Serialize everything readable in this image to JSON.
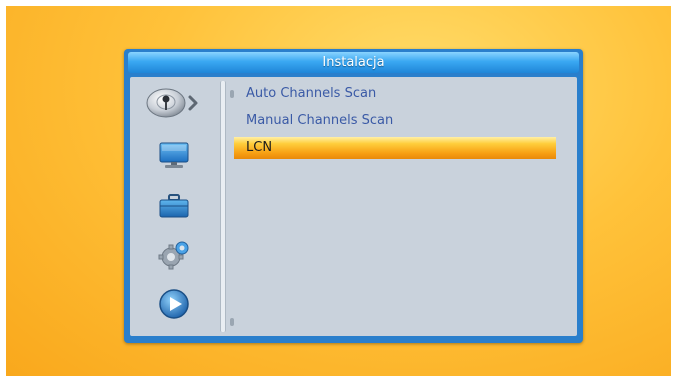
{
  "window": {
    "title": "Instalacja"
  },
  "sidebar": {
    "items": [
      {
        "icon": "satellite-dish-icon",
        "active": true
      },
      {
        "icon": "monitor-icon",
        "active": false
      },
      {
        "icon": "briefcase-icon",
        "active": false
      },
      {
        "icon": "gears-icon",
        "active": false
      },
      {
        "icon": "play-icon",
        "active": false
      }
    ]
  },
  "menu": {
    "items": [
      {
        "label": "Auto Channels Scan",
        "selected": false
      },
      {
        "label": "Manual Channels Scan",
        "selected": false
      },
      {
        "label": "LCN",
        "selected": true
      }
    ]
  },
  "colors": {
    "background": "#ffc23a",
    "window_frame": "#2a7fcc",
    "menu_text": "#3a5aa6",
    "highlight": "#f79e12"
  }
}
